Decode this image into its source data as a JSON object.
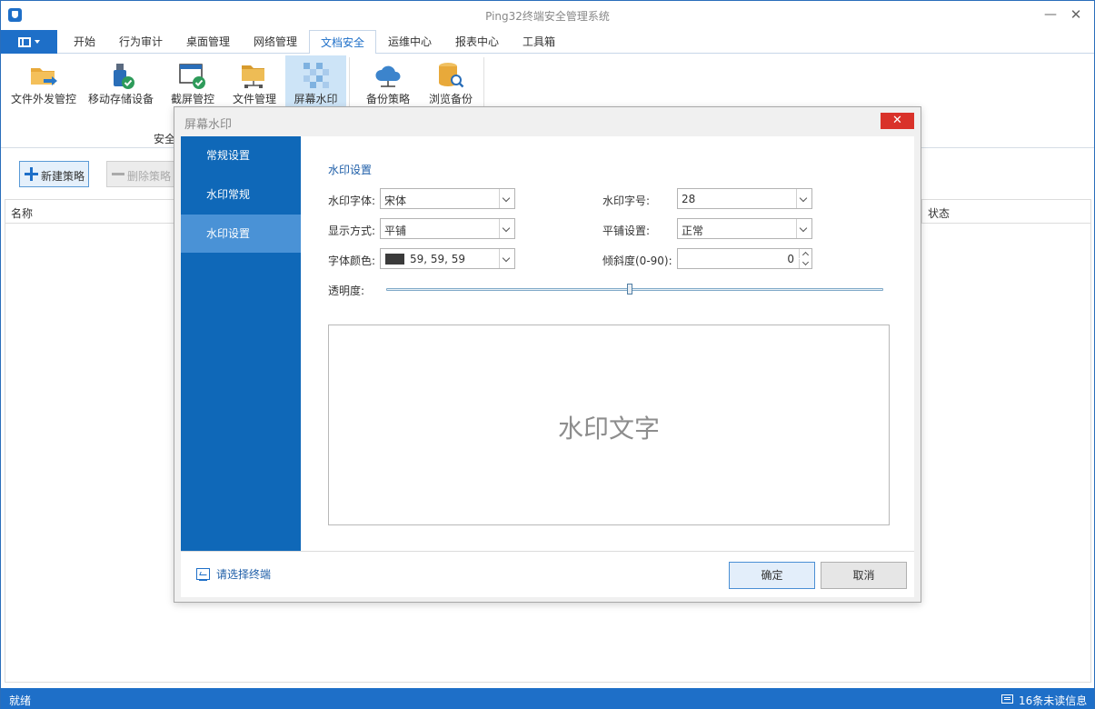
{
  "window": {
    "title": "Ping32终端安全管理系统",
    "minimize_glyph": "—",
    "close_glyph": "✕"
  },
  "menu_tabs": [
    "开始",
    "行为审计",
    "桌面管理",
    "网络管理",
    "文档安全",
    "运维中心",
    "报表中心",
    "工具箱"
  ],
  "active_tab": "文档安全",
  "ribbon": {
    "buttons": [
      {
        "label": "文件外发管控",
        "icon": "folder-send-icon"
      },
      {
        "label": "移动存储设备",
        "icon": "usb-check-icon"
      },
      {
        "label": "截屏管控",
        "icon": "screenshot-check-icon"
      },
      {
        "label": "文件管理",
        "icon": "folder-tree-icon"
      },
      {
        "label": "屏幕水印",
        "icon": "watermark-icon"
      },
      {
        "label": "备份策略",
        "icon": "cloud-icon"
      },
      {
        "label": "浏览备份",
        "icon": "database-search-icon"
      }
    ],
    "active_button": "屏幕水印",
    "group_label_partial": "安全"
  },
  "toolbar": {
    "new_label": "新建策略",
    "delete_label": "删除策略"
  },
  "grid": {
    "columns": [
      "名称",
      "状态"
    ]
  },
  "status": {
    "left": "就绪",
    "right": "16条未读信息"
  },
  "dialog": {
    "title": "屏幕水印",
    "close_glyph": "✕",
    "sidebar": [
      "常规设置",
      "水印常规",
      "水印设置"
    ],
    "active_sidebar": "水印设置",
    "section_title": "水印设置",
    "fields": {
      "font_label": "水印字体:",
      "font_value": "宋体",
      "size_label": "水印字号:",
      "size_value": "28",
      "display_label": "显示方式:",
      "display_value": "平铺",
      "tile_label": "平铺设置:",
      "tile_value": "正常",
      "color_label": "字体颜色:",
      "color_value": "59, 59, 59",
      "color_swatch": "#3b3b3b",
      "tilt_label": "倾斜度(0-90):",
      "tilt_value": "0",
      "opacity_label": "透明度:",
      "opacity_fraction": 0.49
    },
    "preview_text": "水印文字",
    "terminal_link": "请选择终端",
    "ok_label": "确定",
    "cancel_label": "取消"
  },
  "colors": {
    "accent": "#1e6fc8",
    "sidebar": "#0f68b8",
    "sidebar_active": "#4a92d6",
    "close_red": "#d9322a"
  }
}
